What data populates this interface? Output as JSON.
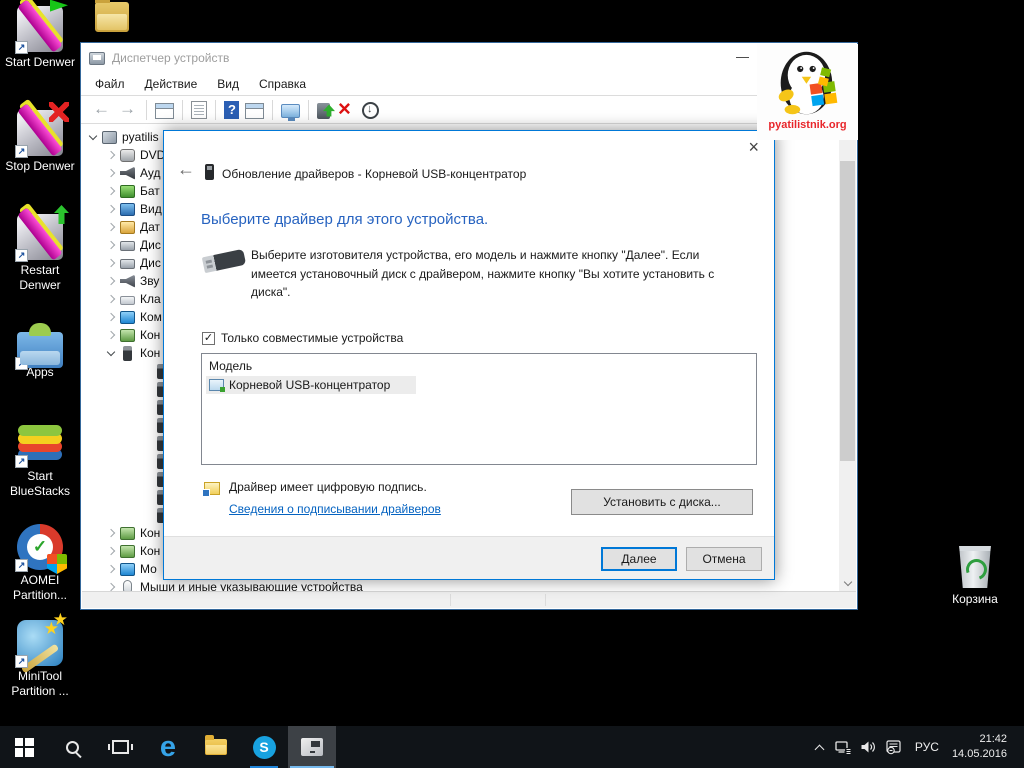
{
  "colors": {
    "accent": "#0078d7",
    "link": "#0563c1",
    "heading_blue": "#2763c0",
    "taskbar": "#101418"
  },
  "desktop": {
    "icons": [
      {
        "label": "Start Denwer",
        "icon": "di-denwer-start",
        "name": "desktop-icon-start-denwer"
      },
      {
        "label": "Stop Denwer",
        "icon": "di-denwer-stop",
        "name": "desktop-icon-stop-denwer"
      },
      {
        "label": "Restart\nDenwer",
        "icon": "di-denwer-restart",
        "name": "desktop-icon-restart-denwer"
      },
      {
        "label": "Apps",
        "icon": "di-apps",
        "name": "desktop-icon-apps"
      },
      {
        "label": "Start\nBlueStacks",
        "icon": "di-bluestacks",
        "name": "desktop-icon-start-bluestacks"
      },
      {
        "label": "AOMEI\nPartition...",
        "icon": "di-aomei",
        "name": "desktop-icon-aomei-partition"
      },
      {
        "label": "MiniTool\nPartition ...",
        "icon": "di-minitool",
        "name": "desktop-icon-minitool-partition"
      }
    ],
    "recycle_bin_label": "Корзина",
    "watermark_text": "pyatilistnik.org"
  },
  "device_manager": {
    "title": "Диспетчер устройств",
    "minimize_glyph": "—",
    "menus": [
      "Файл",
      "Действие",
      "Вид",
      "Справка"
    ],
    "tree": {
      "items": [
        {
          "label": "pyatilis",
          "icon": "ti-computer",
          "name": "tree-item-computer-root",
          "chev": "open",
          "ind": "i0"
        },
        {
          "label": "DVD",
          "icon": "ti-dvd",
          "name": "tree-item-dvd-drives",
          "chev": "closed",
          "ind": "i1"
        },
        {
          "label": "Ауд",
          "icon": "ti-audio",
          "name": "tree-item-audio-inputs",
          "chev": "closed",
          "ind": "i1"
        },
        {
          "label": "Бат",
          "icon": "ti-battery",
          "name": "tree-item-batteries",
          "chev": "closed",
          "ind": "i1"
        },
        {
          "label": "Вид",
          "icon": "ti-video",
          "name": "tree-item-video-adapters",
          "chev": "closed",
          "ind": "i1"
        },
        {
          "label": "Дат",
          "icon": "ti-sensor",
          "name": "tree-item-sensors",
          "chev": "closed",
          "ind": "i1"
        },
        {
          "label": "Дис",
          "icon": "ti-disk",
          "name": "tree-item-disk-devices",
          "chev": "closed",
          "ind": "i1"
        },
        {
          "label": "Дис",
          "icon": "ti-disk",
          "name": "tree-item-dispatchers",
          "chev": "closed",
          "ind": "i1"
        },
        {
          "label": "Зву",
          "icon": "ti-sound",
          "name": "tree-item-sound-devices",
          "chev": "closed",
          "ind": "i1"
        },
        {
          "label": "Кла",
          "icon": "ti-keyboard",
          "name": "tree-item-keyboards",
          "chev": "closed",
          "ind": "i1"
        },
        {
          "label": "Ком",
          "icon": "ti-monitor",
          "name": "tree-item-computer",
          "chev": "closed",
          "ind": "i1"
        },
        {
          "label": "Кон",
          "icon": "ti-controller",
          "name": "tree-item-controllers-ide",
          "chev": "closed",
          "ind": "i1"
        },
        {
          "label": "Кон",
          "icon": "ti-usb",
          "name": "tree-item-usb-controllers",
          "chev": "open",
          "ind": "i1"
        },
        {
          "label": "",
          "icon": "ti-usbplug",
          "name": "tree-item-usb-device",
          "chev": "none",
          "ind": "i2"
        },
        {
          "label": "",
          "icon": "ti-usbplug",
          "name": "tree-item-usb-device",
          "chev": "none",
          "ind": "i2"
        },
        {
          "label": "",
          "icon": "ti-usbplug",
          "name": "tree-item-usb-device",
          "chev": "none",
          "ind": "i2"
        },
        {
          "label": "",
          "icon": "ti-usbplug",
          "name": "tree-item-usb-device",
          "chev": "none",
          "ind": "i2"
        },
        {
          "label": "",
          "icon": "ti-usbplug",
          "name": "tree-item-usb-device",
          "chev": "none",
          "ind": "i2"
        },
        {
          "label": "",
          "icon": "ti-usbplug",
          "name": "tree-item-usb-device",
          "chev": "none",
          "ind": "i2"
        },
        {
          "label": "",
          "icon": "ti-usbplug",
          "name": "tree-item-usb-device",
          "chev": "none",
          "ind": "i2"
        },
        {
          "label": "",
          "icon": "ti-usbplug",
          "name": "tree-item-usb-device",
          "chev": "none",
          "ind": "i2"
        },
        {
          "label": "",
          "icon": "ti-usbplug",
          "name": "tree-item-usb-device",
          "chev": "none",
          "ind": "i2"
        },
        {
          "label": "Кон",
          "icon": "ti-controller",
          "name": "tree-item-controllers-2",
          "chev": "closed",
          "ind": "i1"
        },
        {
          "label": "Кон",
          "icon": "ti-controller",
          "name": "tree-item-controllers-3",
          "chev": "closed",
          "ind": "i1"
        },
        {
          "label": "Мо",
          "icon": "ti-monitor",
          "name": "tree-item-monitors",
          "chev": "closed",
          "ind": "i1"
        },
        {
          "label": "Мыши и иные указывающие устройства",
          "icon": "ti-mouse",
          "name": "tree-item-mice",
          "chev": "closed",
          "ind": "i1"
        }
      ]
    }
  },
  "dialog": {
    "title": "Обновление драйверов - Корневой USB-концентратор",
    "close_glyph": "×",
    "back_glyph": "←",
    "heading": "Выберите драйвер для этого устройства.",
    "body_text": "Выберите изготовителя устройства, его модель и нажмите кнопку \"Далее\". Если имеется установочный диск с  драйвером, нажмите кнопку \"Вы хотите установить с диска\".",
    "checkbox_checked_glyph": "✓",
    "checkbox_label": "Только совместимые устройства",
    "list_header": "Модель",
    "list_item": "Корневой USB-концентратор",
    "signature_text": "Драйвер имеет цифровую подпись.",
    "signature_link": "Сведения о подписывании драйверов",
    "have_disk_button": "Установить с диска...",
    "next_button": "Далее",
    "cancel_button": "Отмена"
  },
  "taskbar": {
    "tray": {
      "lang": "РУС",
      "time": "21:42",
      "date": "14.05.2016"
    }
  }
}
